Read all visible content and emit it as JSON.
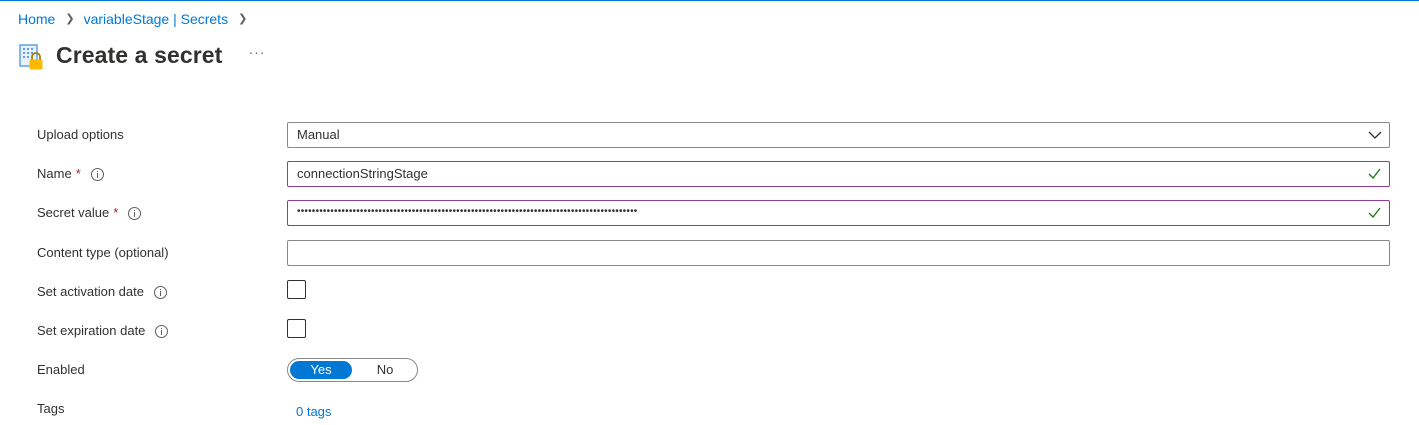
{
  "breadcrumb": {
    "items": [
      {
        "label": "Home"
      },
      {
        "label": "variableStage | Secrets"
      }
    ]
  },
  "page": {
    "title": "Create a secret",
    "more": "···"
  },
  "form": {
    "upload_options": {
      "label": "Upload options",
      "value": "Manual"
    },
    "name": {
      "label": "Name",
      "required_mark": "*",
      "value": "connectionStringStage"
    },
    "secret_value": {
      "label": "Secret value",
      "required_mark": "*",
      "value": "••••••••••••••••••••••••••••••••••••••••••••••••••••••••••••••••••••••••••••••••••••••••••••"
    },
    "content_type": {
      "label": "Content type (optional)",
      "value": ""
    },
    "activation_date": {
      "label": "Set activation date",
      "checked": false
    },
    "expiration_date": {
      "label": "Set expiration date",
      "checked": false
    },
    "enabled": {
      "label": "Enabled",
      "yes": "Yes",
      "no": "No",
      "selected": "Yes"
    },
    "tags": {
      "label": "Tags",
      "value": "0 tags"
    }
  },
  "colors": {
    "accent": "#0078d4",
    "valid_border": "#8a3e96",
    "check": "#107c10",
    "required": "#a4262c"
  }
}
